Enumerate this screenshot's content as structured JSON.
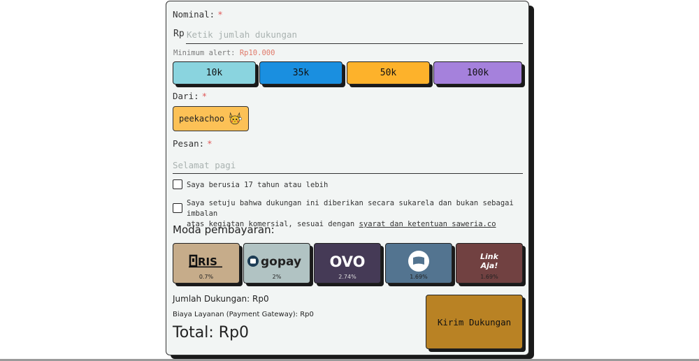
{
  "form": {
    "nominal_label": "Nominal:",
    "required_mark": "*",
    "currency": "Rp",
    "amount_placeholder": "Ketik jumlah dukungan",
    "min_alert_label": "Minimum alert:",
    "min_alert_value": "Rp10.000",
    "presets": [
      {
        "label": "10k",
        "color": "#8ad4df"
      },
      {
        "label": "35k",
        "color": "#1a8fe0"
      },
      {
        "label": "50k",
        "color": "#fdb22b"
      },
      {
        "label": "100k",
        "color": "#a581dc"
      }
    ],
    "from_label": "Dari:",
    "from_name": "peekachoo",
    "message_label": "Pesan:",
    "message_placeholder": "Selamat pagi",
    "check_age": "Saya berusia 17 tahun atau lebih",
    "check_agree_line1": "Saya setuju bahwa dukungan ini diberikan secara sukarela dan bukan sebagai imbalan",
    "check_agree_line2": "atas kegiatan komersial, sesuai dengan",
    "check_agree_link": "syarat dan ketentuan saweria.co"
  },
  "payment": {
    "title": "Moda pembayaran:",
    "methods": [
      {
        "name": "QRIS",
        "fee": "0.7%",
        "color": "#c6ac8a"
      },
      {
        "name": "gopay",
        "fee": "2%",
        "color": "#b1c3c3"
      },
      {
        "name": "OVO",
        "fee": "2.74%",
        "color": "#453a56"
      },
      {
        "name": "ShopeePay",
        "fee": "1.69%",
        "color": "#537490"
      },
      {
        "name": "LinkAja!",
        "fee": "1.69%",
        "color": "#714141"
      }
    ]
  },
  "summary": {
    "support_amount": "Jumlah Dukungan: Rp0",
    "service_fee": "Biaya Layanan (Payment Gateway): Rp0",
    "total": "Total: Rp0"
  },
  "submit_label": "Kirim Dukungan"
}
